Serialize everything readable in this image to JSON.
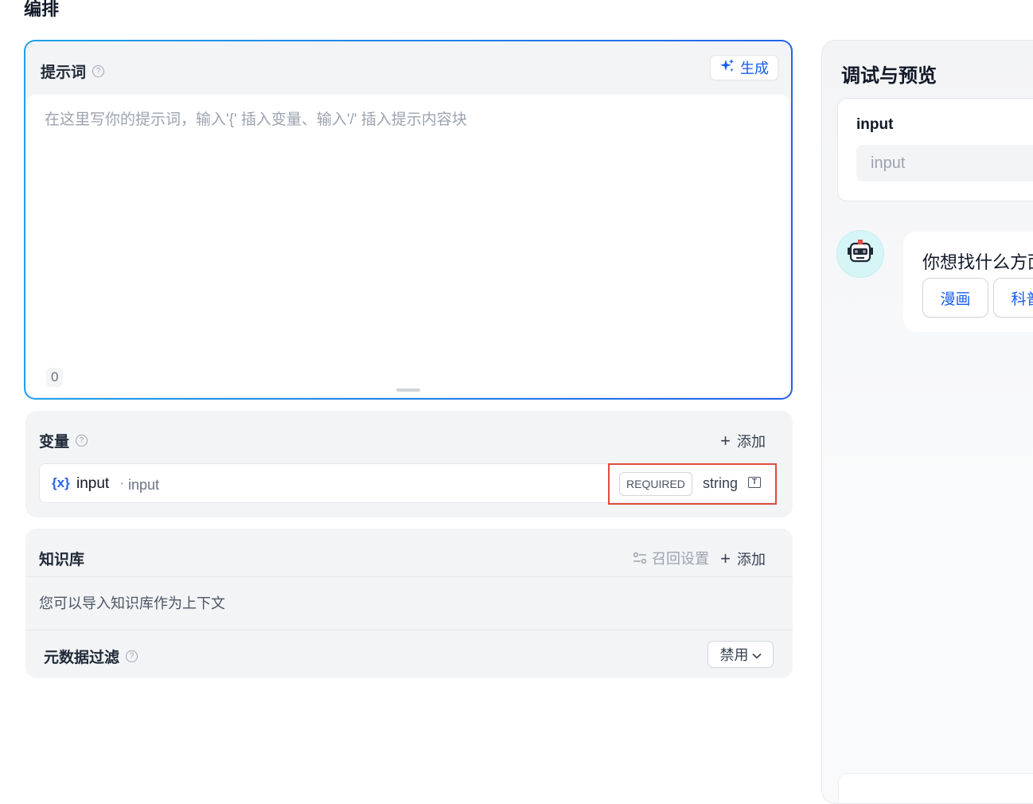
{
  "page": {
    "title": "编排"
  },
  "prompt": {
    "title": "提示词",
    "help": "?",
    "generate_label": "生成",
    "placeholder": "在这里写你的提示词，输入'{' 插入变量、输入'/' 插入提示内容块",
    "char_count": "0"
  },
  "variables": {
    "title": "变量",
    "help": "?",
    "add_label": "添加",
    "items": [
      {
        "icon": "{x}",
        "key": "input",
        "separator": "·",
        "name": "input",
        "required": "REQUIRED",
        "type": "string"
      }
    ]
  },
  "knowledge": {
    "title": "知识库",
    "recall_label": "召回设置",
    "add_label": "添加",
    "description": "您可以导入知识库作为上下文",
    "metadata_filter": {
      "title": "元数据过滤",
      "help": "?",
      "selected": "禁用"
    }
  },
  "preview": {
    "title": "调试与预览",
    "input": {
      "label": "input",
      "placeholder": "input"
    },
    "chat": {
      "message": "你想找什么方面",
      "options": [
        "漫画",
        "科普"
      ]
    }
  },
  "icons": {
    "generate": "sparkle-icon",
    "add": "plus-icon",
    "recall": "sliders-icon",
    "type": "text-type-icon",
    "select": "chevron-down-icon",
    "avatar": "robot-avatar"
  },
  "colors": {
    "accent": "#155eef",
    "border_gradient_start": "#1ea2e8",
    "border_gradient_end": "#2563eb",
    "highlight_box": "#e04c3f",
    "variable_icon": "#2563eb"
  }
}
